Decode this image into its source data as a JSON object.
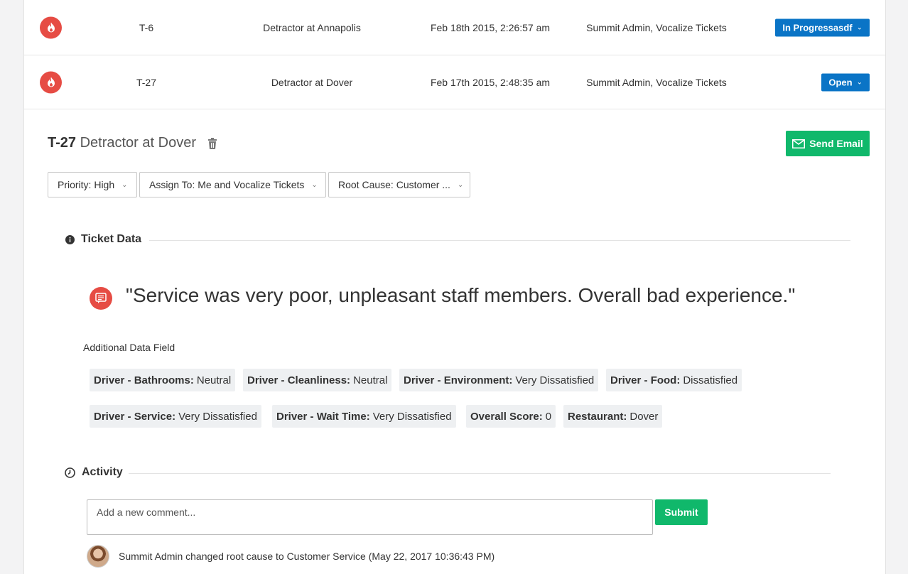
{
  "tickets": [
    {
      "id": "T-6",
      "title": "Detractor at Annapolis",
      "date": "Feb 18th 2015, 2:26:57 am",
      "owners": "Summit Admin, Vocalize Tickets",
      "status": "In Progressasdf"
    },
    {
      "id": "T-27",
      "title": "Detractor at Dover",
      "date": "Feb 17th 2015, 2:48:35 am",
      "owners": "Summit Admin, Vocalize Tickets",
      "status": "Open"
    }
  ],
  "detail": {
    "id": "T-27",
    "title": "Detractor at Dover",
    "send_email_label": "Send Email",
    "priority_label": "Priority: High",
    "assign_label": "Assign To: Me and Vocalize Tickets",
    "root_cause_label": "Root Cause: Customer ..."
  },
  "ticket_data": {
    "heading": "Ticket Data",
    "quote": "\"Service was very poor, unpleasant staff members. Overall bad experience.\"",
    "additional_label": "Additional Data Field",
    "fields": [
      {
        "key": "Driver - Bathrooms:",
        "value": "Neutral"
      },
      {
        "key": "Driver - Cleanliness:",
        "value": "Neutral"
      },
      {
        "key": "Driver - Environment:",
        "value": "Very Dissatisfied"
      },
      {
        "key": "Driver - Food:",
        "value": "Dissatisfied"
      },
      {
        "key": "Driver - Service:",
        "value": "Very Dissatisfied"
      },
      {
        "key": "Driver - Wait Time:",
        "value": "Very Dissatisfied"
      },
      {
        "key": "Overall Score:",
        "value": "0"
      },
      {
        "key": "Restaurant:",
        "value": "Dover"
      }
    ]
  },
  "activity": {
    "heading": "Activity",
    "comment_placeholder": "Add a new comment...",
    "submit_label": "Submit",
    "entries": [
      {
        "text": "Summit Admin changed root cause to Customer Service (May 22, 2017 10:36:43 PM)"
      }
    ]
  },
  "colors": {
    "accent_blue": "#0a74c6",
    "accent_green": "#10b86b",
    "flame_red": "#e64c44"
  }
}
